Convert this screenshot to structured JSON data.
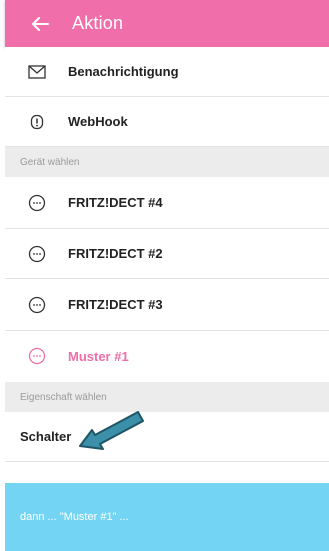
{
  "appbar": {
    "title": "Aktion",
    "back_icon": "arrow-left-icon",
    "color": "#f06ea9"
  },
  "actions": [
    {
      "label": "Benachrichtigung",
      "icon": "envelope-icon"
    },
    {
      "label": "WebHook",
      "icon": "exclamation-badge-icon"
    }
  ],
  "device_section": {
    "title": "Gerät wählen"
  },
  "devices": [
    {
      "label": "FRITZ!DECT #4",
      "icon": "device-dots-icon",
      "selected": false
    },
    {
      "label": "FRITZ!DECT #2",
      "icon": "device-dots-icon",
      "selected": false
    },
    {
      "label": "FRITZ!DECT #3",
      "icon": "device-dots-icon",
      "selected": false
    },
    {
      "label": "Muster #1",
      "icon": "device-dots-icon",
      "selected": true
    }
  ],
  "property_section": {
    "title": "Eigenschaft wählen"
  },
  "properties": [
    {
      "label": "Schalter"
    }
  ],
  "annotation": {
    "icon": "pointer-arrow-icon",
    "color": "#3b8fa8"
  },
  "footer": {
    "text": "dann ... \"Muster #1\" ...",
    "color": "#74d4f4"
  }
}
